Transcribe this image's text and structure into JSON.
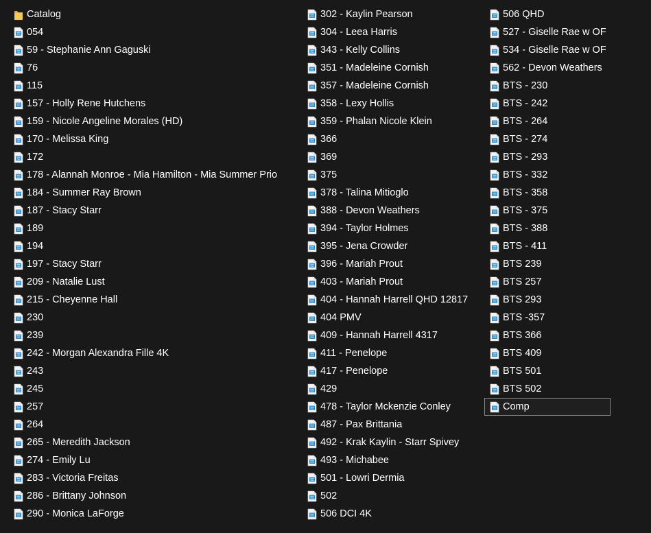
{
  "colors": {
    "background": "#191919",
    "text": "#ffffff",
    "folder": "#e8b84a",
    "file_icon_accent": "#2b8fd6",
    "selection_border": "#8a8a8a"
  },
  "columns": [
    {
      "items": [
        {
          "label": "Catalog",
          "icon": "folder-icon"
        },
        {
          "label": "054",
          "icon": "video-file-icon"
        },
        {
          "label": "59 - Stephanie Ann Gaguski",
          "icon": "video-file-icon"
        },
        {
          "label": "76",
          "icon": "video-file-icon"
        },
        {
          "label": "115",
          "icon": "video-file-icon"
        },
        {
          "label": "157 - Holly Rene Hutchens",
          "icon": "video-file-icon"
        },
        {
          "label": "159 - Nicole Angeline Morales (HD)",
          "icon": "video-file-icon"
        },
        {
          "label": "170 - Melissa King",
          "icon": "video-file-icon"
        },
        {
          "label": "172",
          "icon": "video-file-icon"
        },
        {
          "label": "178 - Alannah Monroe - Mia Hamilton - Mia Summer Prio",
          "icon": "video-file-icon"
        },
        {
          "label": "184 - Summer Ray Brown",
          "icon": "video-file-icon"
        },
        {
          "label": "187 - Stacy Starr",
          "icon": "video-file-icon"
        },
        {
          "label": "189",
          "icon": "video-file-icon"
        },
        {
          "label": "194",
          "icon": "video-file-icon"
        },
        {
          "label": "197 - Stacy Starr",
          "icon": "video-file-icon"
        },
        {
          "label": "209 - Natalie Lust",
          "icon": "video-file-icon"
        },
        {
          "label": "215 - Cheyenne Hall",
          "icon": "video-file-icon"
        },
        {
          "label": "230",
          "icon": "video-file-icon"
        },
        {
          "label": "239",
          "icon": "video-file-icon"
        },
        {
          "label": "242 - Morgan Alexandra Fille 4K",
          "icon": "video-file-icon"
        },
        {
          "label": "243",
          "icon": "video-file-icon"
        },
        {
          "label": "245",
          "icon": "video-file-icon"
        },
        {
          "label": "257",
          "icon": "video-file-icon"
        },
        {
          "label": "264",
          "icon": "video-file-icon"
        },
        {
          "label": "265 - Meredith Jackson",
          "icon": "video-file-icon"
        },
        {
          "label": "274 - Emily Lu",
          "icon": "video-file-icon"
        },
        {
          "label": "283 - Victoria Freitas",
          "icon": "video-file-icon"
        },
        {
          "label": "286 - Brittany Johnson",
          "icon": "video-file-icon"
        },
        {
          "label": "290 - Monica LaForge",
          "icon": "video-file-icon"
        }
      ]
    },
    {
      "items": [
        {
          "label": "302 - Kaylin Pearson",
          "icon": "video-file-icon"
        },
        {
          "label": "304 - Leea Harris",
          "icon": "video-file-icon"
        },
        {
          "label": "343 - Kelly Collins",
          "icon": "video-file-icon"
        },
        {
          "label": "351 - Madeleine Cornish",
          "icon": "video-file-icon"
        },
        {
          "label": "357 - Madeleine Cornish",
          "icon": "video-file-icon"
        },
        {
          "label": "358 - Lexy Hollis",
          "icon": "video-file-icon"
        },
        {
          "label": "359 - Phalan Nicole Klein",
          "icon": "video-file-icon"
        },
        {
          "label": "366",
          "icon": "video-file-icon"
        },
        {
          "label": "369",
          "icon": "video-file-icon"
        },
        {
          "label": "375",
          "icon": "video-file-icon"
        },
        {
          "label": "378 - Talina Mitioglo",
          "icon": "video-file-icon"
        },
        {
          "label": "388 - Devon Weathers",
          "icon": "video-file-icon"
        },
        {
          "label": "394 - Taylor Holmes",
          "icon": "video-file-icon"
        },
        {
          "label": "395 - Jena Crowder",
          "icon": "video-file-icon"
        },
        {
          "label": "396 - Mariah Prout",
          "icon": "video-file-icon"
        },
        {
          "label": "403 - Mariah Prout",
          "icon": "video-file-icon"
        },
        {
          "label": "404 - Hannah Harrell QHD 12817",
          "icon": "video-file-icon"
        },
        {
          "label": "404 PMV",
          "icon": "video-file-icon"
        },
        {
          "label": "409 - Hannah Harrell 4317",
          "icon": "video-file-icon"
        },
        {
          "label": "411 - Penelope",
          "icon": "video-file-icon"
        },
        {
          "label": "417 - Penelope",
          "icon": "video-file-icon"
        },
        {
          "label": "429",
          "icon": "video-file-icon"
        },
        {
          "label": "478 - Taylor Mckenzie Conley",
          "icon": "video-file-icon"
        },
        {
          "label": "487 - Pax Brittania",
          "icon": "video-file-icon"
        },
        {
          "label": "492 - Krak Kaylin - Starr Spivey",
          "icon": "video-file-icon"
        },
        {
          "label": "493 - Michabee",
          "icon": "video-file-icon"
        },
        {
          "label": "501 - Lowri Dermia",
          "icon": "video-file-icon"
        },
        {
          "label": "502",
          "icon": "video-file-icon"
        },
        {
          "label": "506 DCI 4K",
          "icon": "video-file-icon"
        }
      ]
    },
    {
      "items": [
        {
          "label": "506 QHD",
          "icon": "video-file-icon"
        },
        {
          "label": "527 - Giselle Rae w OF",
          "icon": "video-file-icon"
        },
        {
          "label": "534 - Giselle Rae w OF",
          "icon": "video-file-icon"
        },
        {
          "label": "562 -  Devon Weathers",
          "icon": "video-file-icon"
        },
        {
          "label": "BTS - 230",
          "icon": "video-file-icon"
        },
        {
          "label": "BTS - 242",
          "icon": "video-file-icon"
        },
        {
          "label": "BTS - 264",
          "icon": "video-file-icon"
        },
        {
          "label": "BTS - 274",
          "icon": "video-file-icon"
        },
        {
          "label": "BTS - 293",
          "icon": "video-file-icon"
        },
        {
          "label": "BTS - 332",
          "icon": "video-file-icon"
        },
        {
          "label": "BTS - 358",
          "icon": "video-file-icon"
        },
        {
          "label": "BTS - 375",
          "icon": "video-file-icon"
        },
        {
          "label": "BTS - 388",
          "icon": "video-file-icon"
        },
        {
          "label": "BTS - 411",
          "icon": "video-file-icon"
        },
        {
          "label": "BTS 239",
          "icon": "video-file-icon"
        },
        {
          "label": "BTS 257",
          "icon": "video-file-icon"
        },
        {
          "label": "BTS 293",
          "icon": "video-file-icon"
        },
        {
          "label": "BTS -357",
          "icon": "video-file-icon"
        },
        {
          "label": "BTS 366",
          "icon": "video-file-icon"
        },
        {
          "label": "BTS 409",
          "icon": "video-file-icon"
        },
        {
          "label": "BTS 501",
          "icon": "video-file-icon"
        },
        {
          "label": "BTS 502",
          "icon": "video-file-icon"
        },
        {
          "label": "Comp",
          "icon": "video-file-icon",
          "selected": true
        }
      ]
    }
  ]
}
